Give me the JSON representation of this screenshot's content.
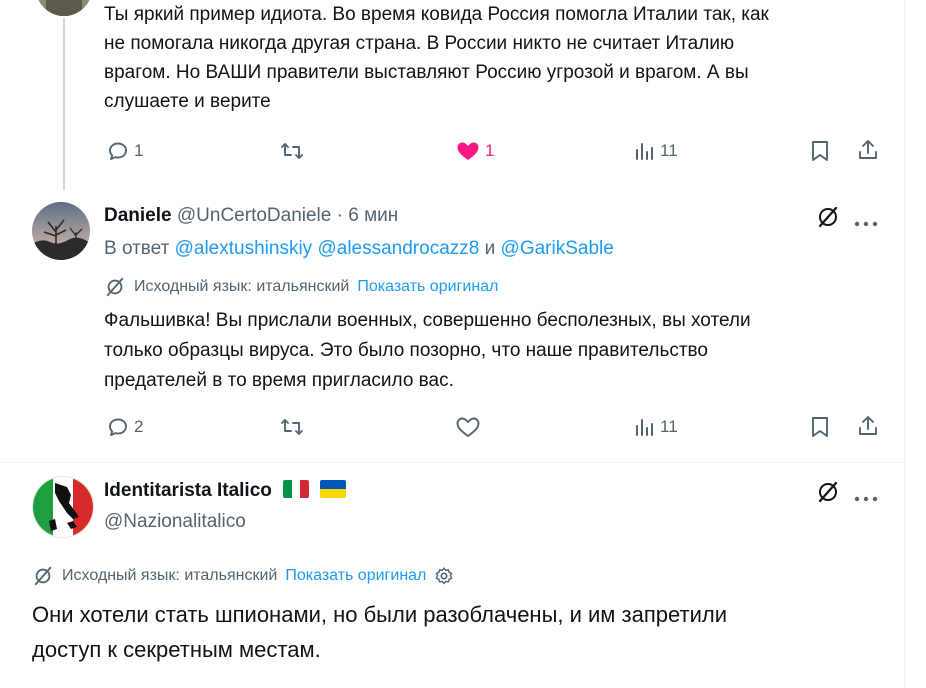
{
  "post1": {
    "text_lines": [
      "Ты яркий пример идиота. Во время ковида Россия помогла Италии так, как",
      "не помогала никогда другая страна. В России никто не считает Италию",
      "врагом. Но ВАШИ правители выставляют Россию угрозой и врагом. А вы",
      "слушаете и верите"
    ],
    "replies": "1",
    "likes": "1",
    "views": "11"
  },
  "post2": {
    "name": "Daniele",
    "handle": "@UnCertoDaniele",
    "sep": "·",
    "time": "6 мин",
    "reply_prefix": "В ответ",
    "mention1": "@alextushinskiy",
    "mention2": "@alessandrocazz8",
    "and": "и",
    "mention3": "@GarikSable",
    "translated_label": "Исходный язык: итальянский",
    "show_original": "Показать оригинал",
    "text_lines": [
      "Фальшивка! Вы прислали военных, совершенно бесполезных, вы хотели",
      "только образцы вируса. Это было позорно, что наше правительство",
      "предателей в то время пригласило вас."
    ],
    "replies": "2",
    "views": "11"
  },
  "post3": {
    "name": "Identitarista Italico",
    "handle": "@Nazionalitalico",
    "translated_label": "Исходный язык: итальянский",
    "show_original": "Показать оригинал",
    "text_lines": [
      "Они хотели стать шпионами, но были разоблачены, и им запретили",
      "доступ к секретным местам."
    ]
  },
  "colors": {
    "text": "#0f1419",
    "muted": "#536471",
    "link": "#1d9bf0",
    "like_active": "#f91880",
    "divider": "#eff3f4"
  }
}
